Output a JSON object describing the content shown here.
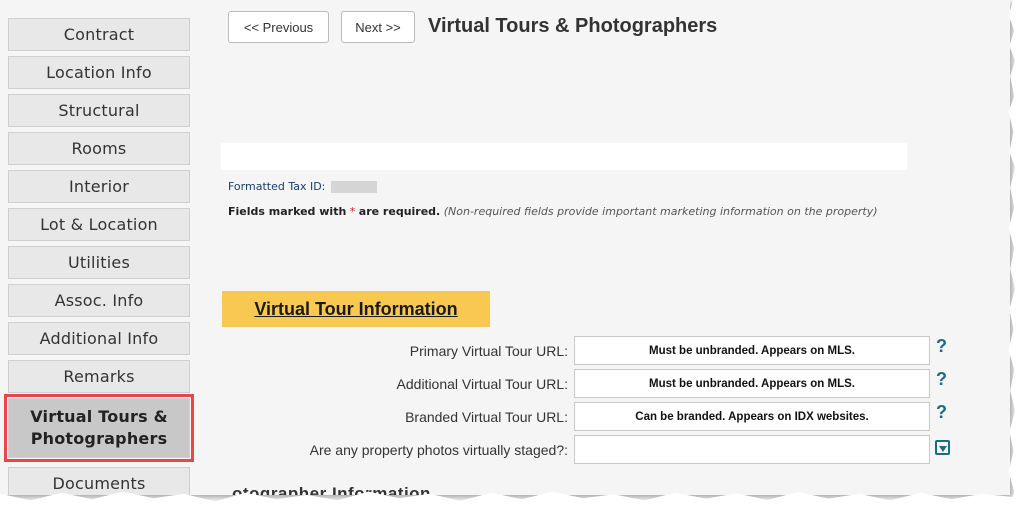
{
  "sidebar": {
    "items": [
      {
        "label": "Contract"
      },
      {
        "label": "Location Info"
      },
      {
        "label": "Structural"
      },
      {
        "label": "Rooms"
      },
      {
        "label": "Interior"
      },
      {
        "label": "Lot & Location"
      },
      {
        "label": "Utilities"
      },
      {
        "label": "Assoc. Info"
      },
      {
        "label": "Additional Info"
      },
      {
        "label": "Remarks"
      },
      {
        "label_line1": "Virtual Tours &",
        "label_line2": "Photographers",
        "active": true
      },
      {
        "label": "Documents"
      }
    ]
  },
  "header": {
    "prev_label": "<< Previous",
    "next_label": "Next >>",
    "title": "Virtual Tours & Photographers"
  },
  "info": {
    "tax_id_label": "Formatted Tax ID:",
    "fields_marked": "Fields marked with",
    "required_star": "*",
    "are_required": "are required.",
    "non_required_note": "(Non-required fields provide important marketing information on the property)"
  },
  "section": {
    "title": "Virtual Tour Information",
    "next_section_partial": "otographer Information"
  },
  "form": {
    "primary": {
      "label": "Primary Virtual Tour URL:",
      "placeholder": "Must be unbranded. Appears on MLS."
    },
    "additional": {
      "label": "Additional Virtual Tour URL:",
      "placeholder": "Must be unbranded. Appears on MLS."
    },
    "branded": {
      "label": "Branded Virtual Tour URL:",
      "placeholder": "Can be branded. Appears on IDX websites."
    },
    "staged": {
      "label": "Are any property photos virtually staged?:",
      "value": ""
    },
    "help_symbol": "?"
  },
  "colors": {
    "section_header_bg": "#f8c850",
    "active_outline": "#e8474a",
    "help_icon": "#1d6b86"
  }
}
